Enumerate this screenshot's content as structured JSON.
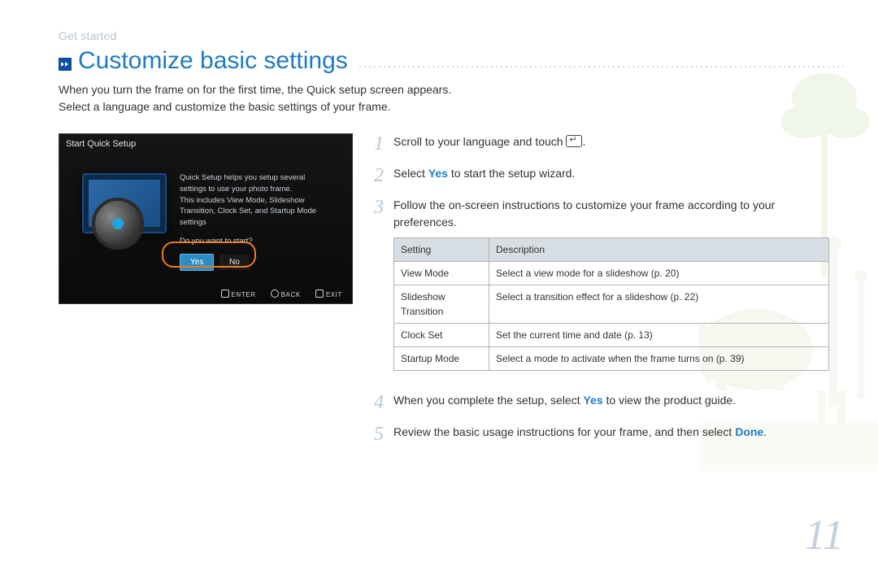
{
  "breadcrumb": "Get started",
  "title": "Customize basic settings",
  "intro_line1": "When you turn the frame on for the first time, the Quick setup screen appears.",
  "intro_line2": "Select a language and customize the basic settings of your frame.",
  "screenshot": {
    "title": "Start Quick Setup",
    "body_lines": [
      "Quick Setup helps you setup several",
      "settings to use your photo frame.",
      "This includes View Mode, Slideshow",
      "Transition, Clock Set, and Startup Mode",
      "settings"
    ],
    "prompt": "Do you want to start?",
    "yes": "Yes",
    "no": "No",
    "footer": {
      "enter": "ENTER",
      "back": "BACK",
      "exit": "EXIT"
    }
  },
  "steps": {
    "s1": {
      "num": "1",
      "pre": "Scroll to your language and touch ",
      "post": "."
    },
    "s2": {
      "num": "2",
      "pre": "Select ",
      "yes": "Yes",
      "post": " to start the setup wizard."
    },
    "s3": {
      "num": "3",
      "text": "Follow the on-screen instructions to customize your frame according to your preferences."
    },
    "s4": {
      "num": "4",
      "pre": "When you complete the setup, select ",
      "yes": "Yes",
      "post": " to view the product guide."
    },
    "s5": {
      "num": "5",
      "pre": "Review the basic usage instructions for your frame, and then select ",
      "done": "Done",
      "post": "."
    }
  },
  "table": {
    "header_setting": "Setting",
    "header_desc": "Description",
    "rows": [
      {
        "setting": "View Mode",
        "desc": "Select a view mode for a slideshow (p. 20)"
      },
      {
        "setting": "Slideshow Transition",
        "desc": "Select a transition effect for a slideshow (p. 22)"
      },
      {
        "setting": "Clock Set",
        "desc": "Set the current time and date (p. 13)"
      },
      {
        "setting": "Startup Mode",
        "desc": "Select a mode to activate when the frame turns on (p. 39)"
      }
    ]
  },
  "page_number": "11"
}
